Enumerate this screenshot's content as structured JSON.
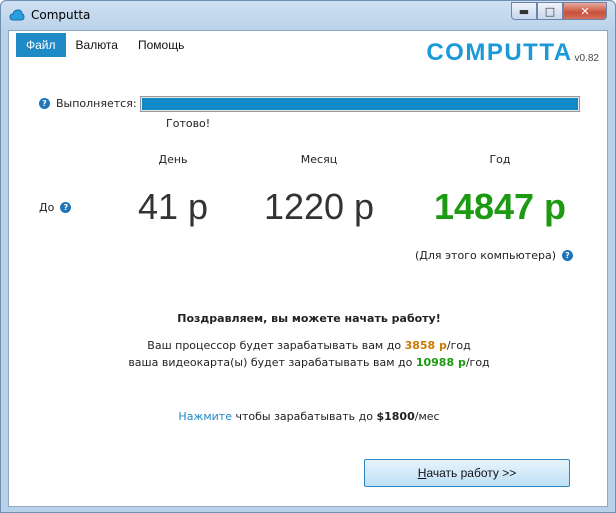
{
  "window": {
    "title": "Computta",
    "min_glyph": "▬",
    "max_glyph": "□",
    "close_glyph": "✕"
  },
  "menu": {
    "items": [
      "Файл",
      "Валюта",
      "Помощь"
    ]
  },
  "logo": {
    "text": "COMPUTTA",
    "version": "v0.82",
    "color": "#1a9ad6"
  },
  "progress": {
    "label": "Выполняется:",
    "status": "Готово!",
    "fill_fraction": 1.0,
    "color": "#1289c8"
  },
  "earnings": {
    "headers": [
      "День",
      "Месяц",
      "Год"
    ],
    "row_label": "До",
    "day": "41 р",
    "month": "1220 р",
    "year": "14847 р",
    "note": "(Для этого компьютера)"
  },
  "message": {
    "congrats": "Поздравляем, вы можете начать работу!",
    "cpu_prefix": "Ваш процессор будет зарабатывать вам до",
    "cpu_amount": "3858 р",
    "cpu_suffix": "/год",
    "gpu_prefix": "ваша видеокарта(ы) будет зарабатывать вам до",
    "gpu_amount": "10988 р",
    "gpu_suffix": "/год",
    "cta_link": "Нажмите",
    "cta_text": "чтобы зарабатывать до",
    "cta_amount": "$1800",
    "cta_suffix": "/мес"
  },
  "button": {
    "start_underlined": "Н",
    "start_rest": "ачать работу >>"
  },
  "icons": [
    "cloud-icon",
    "help-icon",
    "minimize-icon",
    "maximize-icon",
    "close-icon"
  ]
}
